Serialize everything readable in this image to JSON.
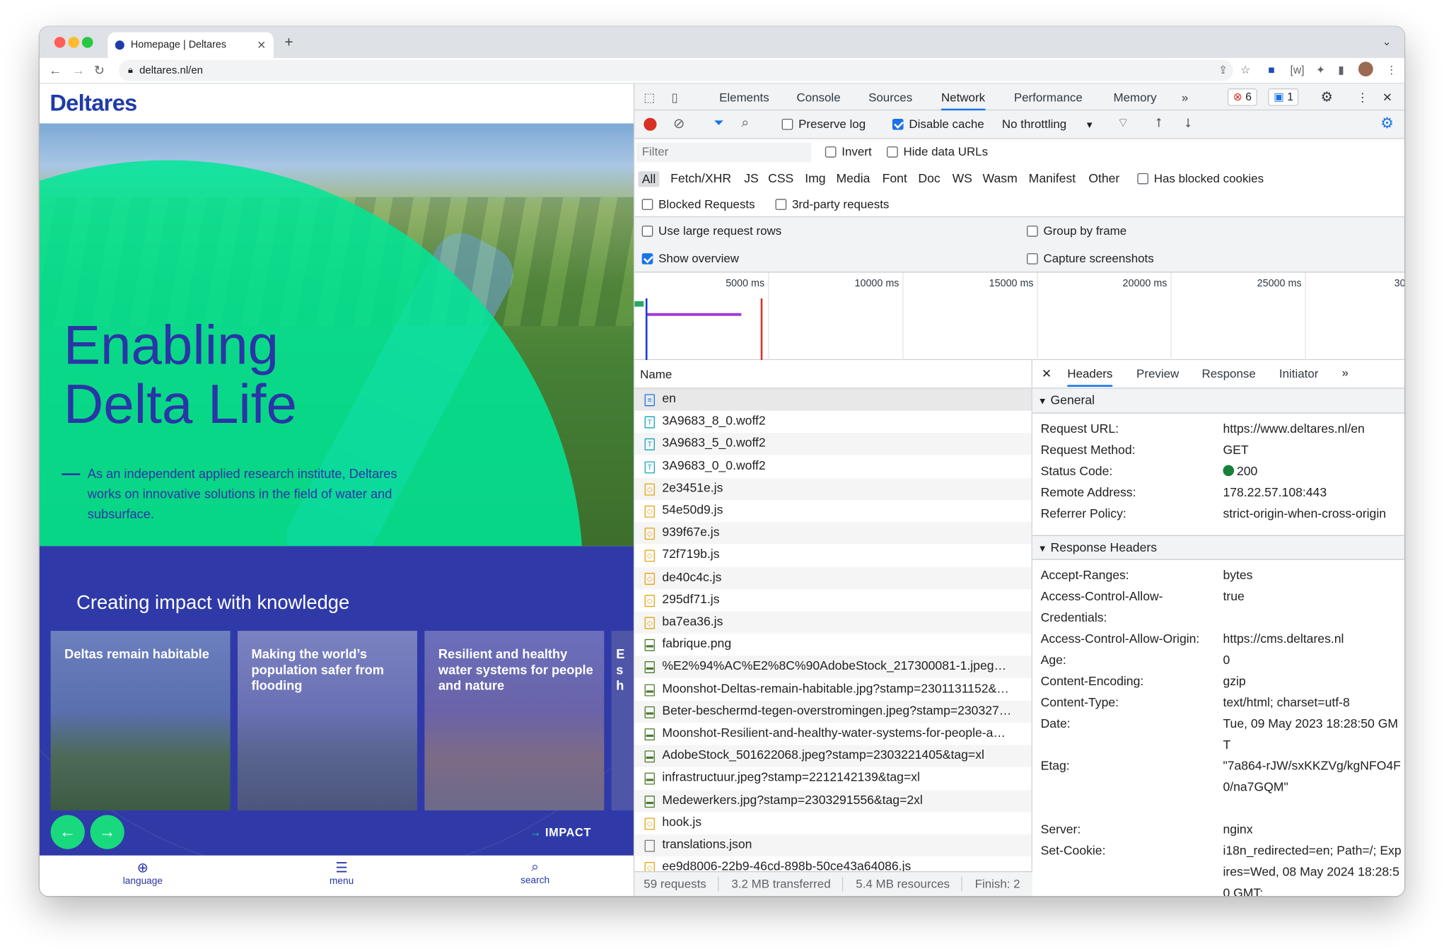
{
  "browser": {
    "tab_title": "Homepage | Deltares",
    "url": "deltares.nl/en"
  },
  "site": {
    "logo": "Deltares",
    "hero_title_line1": "Enabling",
    "hero_title_line2": "Delta Life",
    "hero_description": "As an independent applied research institute, Deltares works on innovative solutions in the field of water and subsurface.",
    "impact_heading": "Creating impact with knowledge",
    "cards": [
      "Deltas remain habitable",
      "Making the world’s population safer from flooding",
      "Resilient and healthy water systems for people and nature",
      "E s h"
    ],
    "impact_link": "IMPACT",
    "bottom_nav": [
      "language",
      "menu",
      "search"
    ]
  },
  "devtools": {
    "tabs": [
      "Elements",
      "Console",
      "Sources",
      "Network",
      "Performance",
      "Memory"
    ],
    "active_tab": "Network",
    "errors_count": "6",
    "messages_count": "1",
    "preserve_log": "Preserve log",
    "disable_cache": "Disable cache",
    "throttling": "No throttling",
    "filter_placeholder": "Filter",
    "invert": "Invert",
    "hide_data_urls": "Hide data URLs",
    "type_filters": [
      "All",
      "Fetch/XHR",
      "JS",
      "CSS",
      "Img",
      "Media",
      "Font",
      "Doc",
      "WS",
      "Wasm",
      "Manifest",
      "Other"
    ],
    "has_blocked_cookies": "Has blocked cookies",
    "blocked_requests": "Blocked Requests",
    "third_party": "3rd-party requests",
    "use_large_rows": "Use large request rows",
    "group_by_frame": "Group by frame",
    "show_overview": "Show overview",
    "capture_screenshots": "Capture screenshots",
    "timeline_ticks": [
      "5000 ms",
      "10000 ms",
      "15000 ms",
      "20000 ms",
      "25000 ms",
      "30"
    ],
    "name_column": "Name",
    "requests": [
      {
        "name": "en",
        "type": "doc"
      },
      {
        "name": "3A9683_8_0.woff2",
        "type": "font"
      },
      {
        "name": "3A9683_5_0.woff2",
        "type": "font"
      },
      {
        "name": "3A9683_0_0.woff2",
        "type": "font"
      },
      {
        "name": "2e3451e.js",
        "type": "js"
      },
      {
        "name": "54e50d9.js",
        "type": "js"
      },
      {
        "name": "939f67e.js",
        "type": "js"
      },
      {
        "name": "72f719b.js",
        "type": "js"
      },
      {
        "name": "de40c4c.js",
        "type": "js"
      },
      {
        "name": "295df71.js",
        "type": "js"
      },
      {
        "name": "ba7ea36.js",
        "type": "js"
      },
      {
        "name": "fabrique.png",
        "type": "img"
      },
      {
        "name": "%E2%94%AC%E2%8C%90AdobeStock_217300081-1.jpeg…",
        "type": "img"
      },
      {
        "name": "Moonshot-Deltas-remain-habitable.jpg?stamp=2301131152&…",
        "type": "img"
      },
      {
        "name": "Beter-beschermd-tegen-overstromingen.jpeg?stamp=230327…",
        "type": "img"
      },
      {
        "name": "Moonshot-Resilient-and-healthy-water-systems-for-people-a…",
        "type": "img"
      },
      {
        "name": "AdobeStock_501622068.jpeg?stamp=2303221405&tag=xl",
        "type": "img"
      },
      {
        "name": "infrastructuur.jpeg?stamp=2212142139&tag=xl",
        "type": "img"
      },
      {
        "name": "Medewerkers.jpg?stamp=2303291556&tag=2xl",
        "type": "img"
      },
      {
        "name": "hook.js",
        "type": "js"
      },
      {
        "name": "translations.json",
        "type": "other"
      },
      {
        "name": "ee9d8006-22b9-46cd-898b-50ce43a64086.js",
        "type": "js"
      }
    ],
    "summary": {
      "requests": "59 requests",
      "transferred": "3.2 MB transferred",
      "resources": "5.4 MB resources",
      "finish": "Finish: 2"
    },
    "detail_tabs": [
      "Headers",
      "Preview",
      "Response",
      "Initiator"
    ],
    "general_title": "General",
    "general": [
      [
        "Request URL:",
        "https://www.deltares.nl/en"
      ],
      [
        "Request Method:",
        "GET"
      ],
      [
        "Status Code:",
        "200"
      ],
      [
        "Remote Address:",
        "178.22.57.108:443"
      ],
      [
        "Referrer Policy:",
        "strict-origin-when-cross-origin"
      ]
    ],
    "response_headers_title": "Response Headers",
    "response_headers": [
      [
        "Accept-Ranges:",
        "bytes"
      ],
      [
        "Access-Control-Allow-Credentials:",
        "true"
      ],
      [
        "Access-Control-Allow-Origin:",
        "https://cms.deltares.nl"
      ],
      [
        "Age:",
        "0"
      ],
      [
        "Content-Encoding:",
        "gzip"
      ],
      [
        "Content-Type:",
        "text/html; charset=utf-8"
      ],
      [
        "Date:",
        "Tue, 09 May 2023 18:28:50 GMT"
      ],
      [
        "Etag:",
        "\"7a864-rJW/sxKKZVg/kgNFO4F0/na7GQM\""
      ],
      [
        "Server:",
        "nginx"
      ],
      [
        "Set-Cookie:",
        "i18n_redirected=en; Path=/; Expires=Wed, 08 May 2024 18:28:50 GMT;"
      ]
    ]
  },
  "colors": {
    "brand_blue": "#2a35a6",
    "brand_green": "#19d97f",
    "devtools_accent": "#1a73e8",
    "record_red": "#d93025"
  }
}
